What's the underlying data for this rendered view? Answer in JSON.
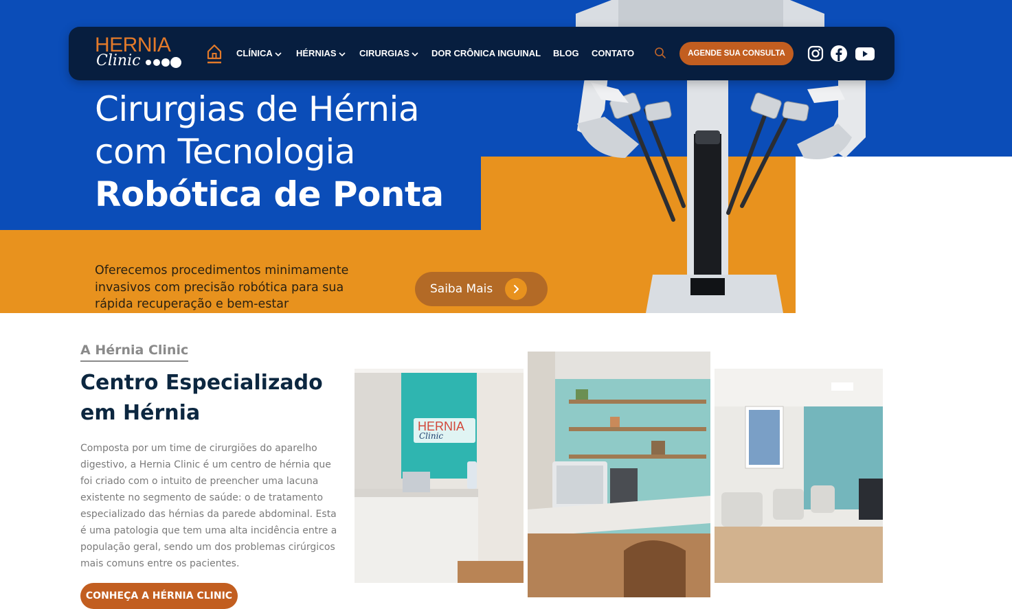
{
  "nav": {
    "logo_word": "HERNIA",
    "logo_script": "Clinic",
    "items": [
      {
        "label": "CLÍNICA",
        "dropdown": true
      },
      {
        "label": "HÉRNIAS",
        "dropdown": true
      },
      {
        "label": "CIRURGIAS",
        "dropdown": true
      },
      {
        "label": "DOR CRÔNICA INGUINAL",
        "dropdown": false
      },
      {
        "label": "BLOG",
        "dropdown": false
      },
      {
        "label": "CONTATO",
        "dropdown": false
      }
    ],
    "cta_label": "AGENDE SUA CONSULTA",
    "icons": [
      "home-icon",
      "search-icon",
      "instagram-icon",
      "facebook-icon",
      "youtube-icon"
    ]
  },
  "hero": {
    "title_line1": "Cirurgias de Hérnia",
    "title_line2": "com Tecnologia",
    "title_line3": "Robótica de Ponta",
    "subtitle": "Oferecemos procedimentos minimamente invasivos com precisão robótica para sua rápida recuperação e bem-estar",
    "button_label": "Saiba Mais"
  },
  "about": {
    "eyebrow": "A Hérnia Clinic",
    "title": "Centro Especializado em Hérnia",
    "body": "Composta por um time de cirurgiões do aparelho digestivo, a Hernia Clinic é um centro de hérnia que foi criado com o intuito de preencher uma lacuna existente no segmento de saúde: o de tratamento especializado das hérnias da parede abdominal. Esta é uma patologia que tem uma alta incidência entre a população geral, sendo um dos problemas cirúrgicos mais comuns entre os pacientes.",
    "button_label": "CONHEÇA A HÉRNIA CLINIC",
    "photo_sign_word": "HERNIA",
    "photo_sign_script": "Clinic"
  },
  "colors": {
    "brand_blue": "#0b4db8",
    "navy": "#071e3f",
    "orange": "#e8921e",
    "cta_orange": "#c25e20"
  }
}
